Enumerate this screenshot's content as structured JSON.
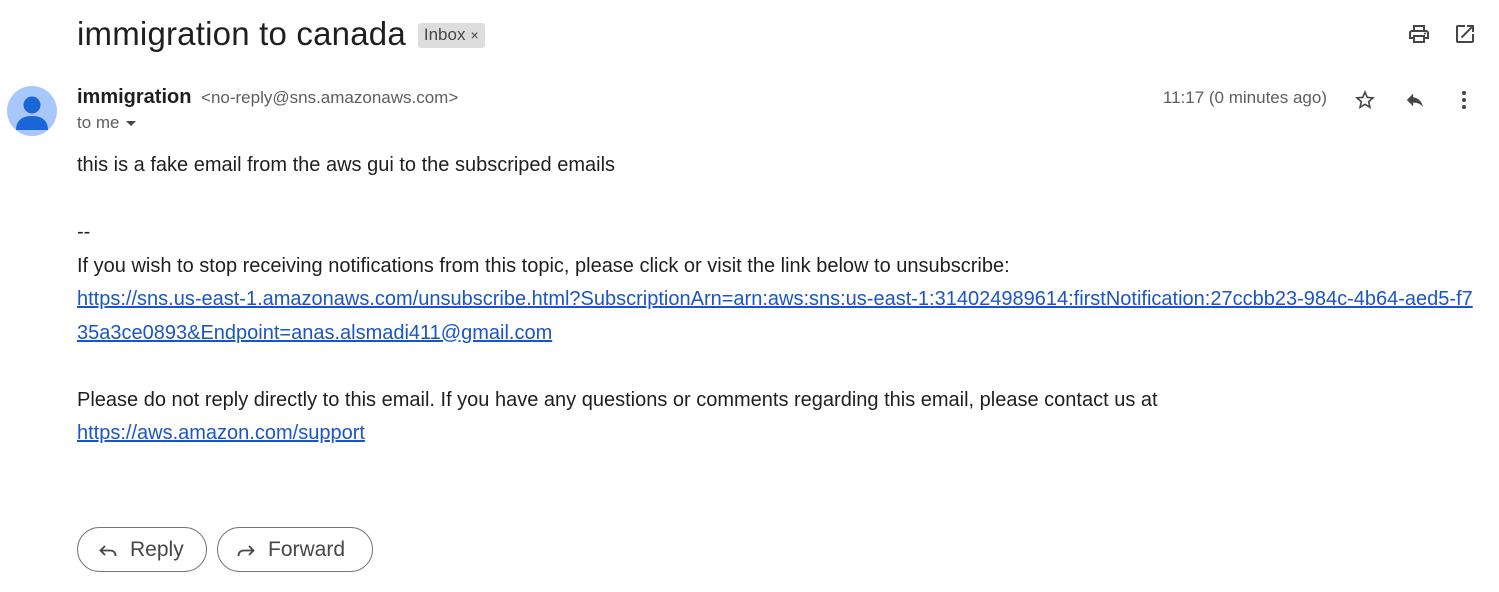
{
  "subject": "immigration to canada",
  "label_chip": {
    "label": "Inbox",
    "remove_glyph": "×"
  },
  "toolbar": {
    "icons": [
      "print-icon",
      "open-in-new-window-icon"
    ]
  },
  "message": {
    "sender_name": "immigration",
    "sender_email": "<no-reply@sns.amazonaws.com>",
    "recipient": "to me",
    "timestamp": "11:17 (0 minutes ago)",
    "action_icons": [
      "star-icon",
      "reply-icon",
      "more-vert-icon"
    ],
    "avatar_color": "#a8c7fa",
    "body": {
      "line1": "this is a fake email from the aws gui to the subscriped emails",
      "separator": "--",
      "unsubscribe_text": "If you wish to stop receiving notifications from this topic, please click or visit the link below to unsubscribe:",
      "unsubscribe_link": "https://sns.us-east-1.amazonaws.com/unsubscribe.html?SubscriptionArn=arn:aws:sns:us-east-1:314024989614:firstNotification:27ccbb23-984c-4b64-aed5-f735a3ce0893&Endpoint=anas.alsmadi411@gmail.com",
      "contact_text": "Please do not reply directly to this email. If you have any questions or comments regarding this email, please contact us at",
      "support_link": "https://aws.amazon.com/support"
    }
  },
  "actions": {
    "reply_label": "Reply",
    "forward_label": "Forward"
  },
  "colors": {
    "link": "#1a55c8",
    "chip_bg": "#dddddd",
    "text": "#1f1f1f",
    "muted": "#5e5e5e"
  }
}
